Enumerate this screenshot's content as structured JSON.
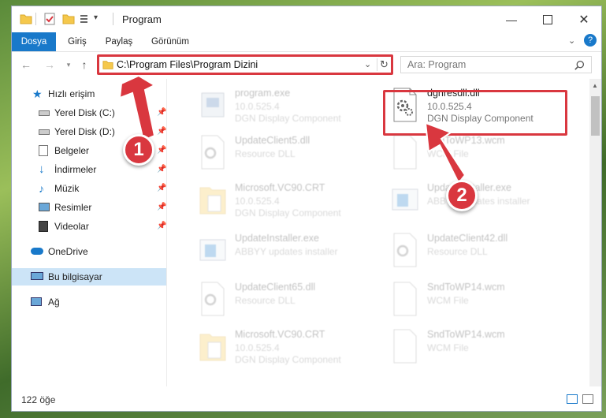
{
  "window": {
    "title": "Program"
  },
  "ribbon": {
    "tabs": [
      {
        "label": "Dosya",
        "active": true
      },
      {
        "label": "Giriş",
        "active": false
      },
      {
        "label": "Paylaş",
        "active": false
      },
      {
        "label": "Görünüm",
        "active": false
      }
    ]
  },
  "address": {
    "path": "C:\\Program Files\\Program Dizini"
  },
  "search": {
    "placeholder": "Ara: Program"
  },
  "sidebar": {
    "items": [
      {
        "label": "Hızlı erişim",
        "icon": "star-icon"
      },
      {
        "label": "Yerel Disk (C:)",
        "icon": "drive-icon",
        "pinned": true
      },
      {
        "label": "Yerel Disk (D:)",
        "icon": "drive-icon",
        "pinned": true
      },
      {
        "label": "Belgeler",
        "icon": "documents-icon",
        "pinned": true
      },
      {
        "label": "İndirmeler",
        "icon": "download-icon",
        "pinned": true
      },
      {
        "label": "Müzik",
        "icon": "music-icon",
        "pinned": true
      },
      {
        "label": "Resimler",
        "icon": "pictures-icon",
        "pinned": true
      },
      {
        "label": "Videolar",
        "icon": "videos-icon",
        "pinned": true
      },
      {
        "label": "OneDrive",
        "icon": "cloud-icon"
      },
      {
        "label": "Bu bilgisayar",
        "icon": "computer-icon",
        "selected": true
      },
      {
        "label": "Ağ",
        "icon": "network-icon"
      }
    ]
  },
  "files": [
    {
      "name": "program.exe",
      "line1": "10.0.525.4",
      "line2": "DGN Display Component",
      "icon": "exe-icon"
    },
    {
      "name": "dgnresdll.dll",
      "line1": "10.0.525.4",
      "line2": "DGN Display Component",
      "icon": "dll-gear-icon"
    },
    {
      "name": "UpdateClient5.dll",
      "line1": "Resource DLL",
      "line2": "",
      "icon": "dll-gear-icon"
    },
    {
      "name": "SndToWP13.wcm",
      "line1": "WCM File",
      "line2": "",
      "icon": "file-icon"
    },
    {
      "name": "Microsoft.VC90.CRT",
      "line1": "10.0.525.4",
      "line2": "DGN Display Component",
      "icon": "folder-file-icon"
    },
    {
      "name": "UpdateInstaller.exe",
      "line1": "ABBYY updates installer",
      "line2": "",
      "icon": "installer-icon"
    },
    {
      "name": "UpdateInstaller.exe",
      "line1": "ABBYY updates installer",
      "line2": "",
      "icon": "installer-icon"
    },
    {
      "name": "UpdateClient42.dll",
      "line1": "Resource DLL",
      "line2": "",
      "icon": "dll-gear-icon"
    },
    {
      "name": "UpdateClient65.dll",
      "line1": "Resource DLL",
      "line2": "",
      "icon": "dll-gear-icon"
    },
    {
      "name": "SndToWP14.wcm",
      "line1": "WCM File",
      "line2": "",
      "icon": "file-icon"
    },
    {
      "name": "Microsoft.VC90.CRT",
      "line1": "10.0.525.4",
      "line2": "DGN Display Component",
      "icon": "folder-file-icon"
    },
    {
      "name": "SndToWP14.wcm",
      "line1": "WCM File",
      "line2": "",
      "icon": "file-icon"
    }
  ],
  "status": {
    "count": "122 öğe"
  },
  "annotations": {
    "callout1": "1",
    "callout2": "2"
  },
  "colors": {
    "accent": "#1979ca",
    "highlight": "#d9373f",
    "selected": "#cce4f7"
  }
}
